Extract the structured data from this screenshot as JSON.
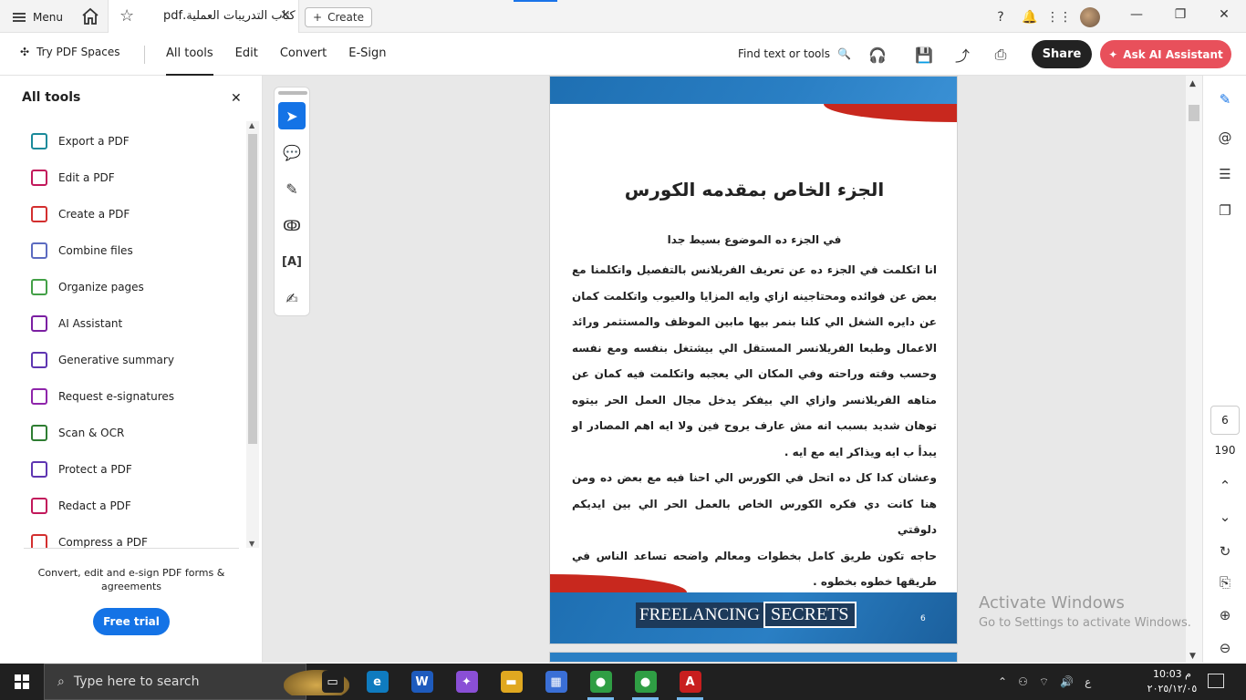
{
  "titlebar": {
    "menu_label": "Menu",
    "tab_title": "كتاب التدريبات العملية.pdf",
    "create_label": "Create"
  },
  "toolbar": {
    "try_pdf_spaces": "Try PDF Spaces",
    "tabs": [
      "All tools",
      "Edit",
      "Convert",
      "E-Sign"
    ],
    "active_tab": "All tools",
    "find_label": "Find text or tools",
    "share_label": "Share",
    "ai_label": "Ask AI Assistant",
    "ai_color": "#e8505b"
  },
  "left_panel": {
    "title": "All tools",
    "tools": [
      {
        "label": "Export a PDF",
        "icon": "export-pdf-icon",
        "color": "#1a8a9a"
      },
      {
        "label": "Edit a PDF",
        "icon": "edit-pdf-icon",
        "color": "#c2185b"
      },
      {
        "label": "Create a PDF",
        "icon": "create-pdf-icon",
        "color": "#d32f2f"
      },
      {
        "label": "Combine files",
        "icon": "combine-files-icon",
        "color": "#5c6bc0"
      },
      {
        "label": "Organize pages",
        "icon": "organize-pages-icon",
        "color": "#43a047"
      },
      {
        "label": "AI Assistant",
        "icon": "ai-assistant-icon",
        "color": "#7b1fa2"
      },
      {
        "label": "Generative summary",
        "icon": "generative-summary-icon",
        "color": "#5e35b1"
      },
      {
        "label": "Request e-signatures",
        "icon": "request-esignatures-icon",
        "color": "#8e24aa"
      },
      {
        "label": "Scan & OCR",
        "icon": "scan-ocr-icon",
        "color": "#2e7d32"
      },
      {
        "label": "Protect a PDF",
        "icon": "protect-pdf-icon",
        "color": "#5e35b1"
      },
      {
        "label": "Redact a PDF",
        "icon": "redact-pdf-icon",
        "color": "#c2185b"
      },
      {
        "label": "Compress a PDF",
        "icon": "compress-pdf-icon",
        "color": "#d32f2f"
      }
    ],
    "promo_text": "Convert, edit and e-sign PDF forms & agreements",
    "trial_label": "Free trial"
  },
  "document": {
    "heading": "الجزء الخاص بمقدمه الكورس",
    "subheading": "في الجزء ده الموضوع بسيط جدا",
    "paragraphs": [
      "انا اتكلمت في الجزء ده عن تعريف الفريلانس بالتفصيل واتكلمنا مع بعض عن فوائده ومحتاجينه ازاي وايه المزايا والعيوب واتكلمت كمان عن دايره الشغل الي كلنا بنمر بيها مابين الموظف والمستثمر ورائد الاعمال وطبعا الفريلانسر المستقل الي بيشتغل بنفسه ومع نفسه وحسب وقته وراحته وفي المكان الي يعجبه واتكلمت فيه كمان عن متاهه الفريلانسر وازاي الي بيفكر يدخل مجال العمل الحر بيتوه توهان شديد بسبب انه مش عارف يروح فين ولا ايه اهم المصادر او يبدأ ب ايه ويذاكر ايه مع ايه .",
      "وعشان كدا كل ده اتحل في الكورس الي احنا فيه مع بعض ده ومن هنا كانت دي فكره الكورس الخاص بالعمل الحر الي بين ايديكم دلوقتي",
      "حاجه تكون طريق كامل بخطوات ومعالم واضحه تساعد الناس في طريقها خطوه بخطوه ."
    ],
    "footer_word1": "FREELANCING",
    "footer_word2": "SECRETS",
    "page_number_label": "6"
  },
  "navigation": {
    "current_page": "6",
    "total_pages": "190"
  },
  "watermark": {
    "line1": "Activate Windows",
    "line2": "Go to Settings to activate Windows."
  },
  "taskbar": {
    "search_placeholder": "Type here to search",
    "apps": [
      {
        "name": "task-view",
        "color": "#202020",
        "glyph": "▭"
      },
      {
        "name": "edge",
        "color": "#0f7bbf",
        "glyph": "e"
      },
      {
        "name": "word",
        "color": "#1e5bbd",
        "glyph": "W"
      },
      {
        "name": "copilot",
        "color": "#8a4fd6",
        "glyph": "✦"
      },
      {
        "name": "file-explorer",
        "color": "#e0a820",
        "glyph": "▬"
      },
      {
        "name": "store",
        "color": "#3a6fd6",
        "glyph": "▦"
      },
      {
        "name": "chrome",
        "color": "#2f9e44",
        "glyph": "●"
      },
      {
        "name": "chrome-profile",
        "color": "#2f9e44",
        "glyph": "●"
      },
      {
        "name": "acrobat",
        "color": "#c81e1e",
        "glyph": "A"
      }
    ],
    "tray_lang": "ع",
    "time": "م 10:03",
    "date": "٢٠٢٥/١٢/٠٥"
  }
}
